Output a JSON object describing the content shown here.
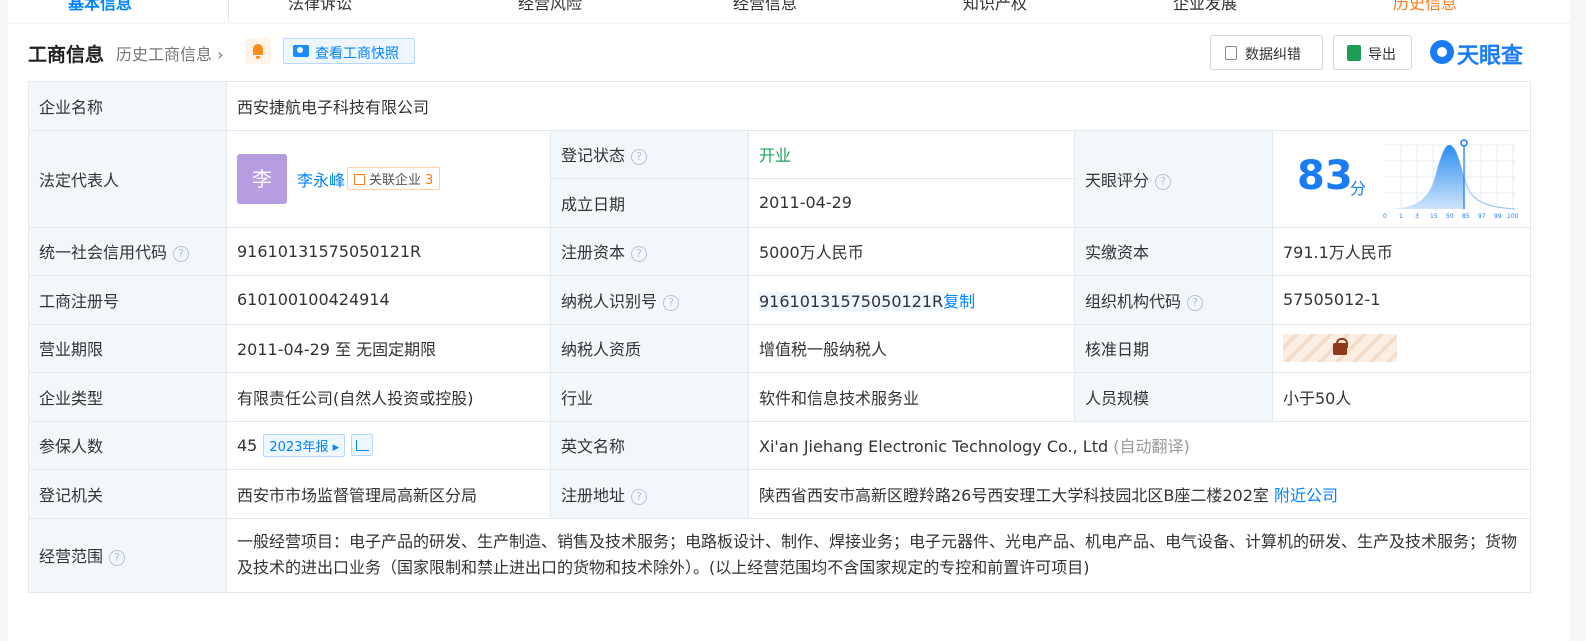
{
  "tabs": [
    {
      "label": "基本信息",
      "active": true
    },
    {
      "label": "法律诉讼"
    },
    {
      "label": "经营风险"
    },
    {
      "label": "经营信息"
    },
    {
      "label": "知识产权"
    },
    {
      "label": "企业发展"
    },
    {
      "label": "历史信息"
    }
  ],
  "header": {
    "title": "工商信息",
    "history": "历史工商信息",
    "snapshot_label": "查看工商快照",
    "correct_label": "数据纠错",
    "export_label": "导出",
    "logo_text": "天眼查"
  },
  "colors": {
    "accent": "#0084ff",
    "green": "#1aa35a",
    "orange": "#ff7a1a",
    "key_bg": "#f2f7fc"
  },
  "info": {
    "company_name_label": "企业名称",
    "company_name": "西安捷航电子科技有限公司",
    "legal_rep_label": "法定代表人",
    "legal_rep_avatar": "李",
    "legal_rep_name": "李永峰",
    "related_label": "关联企业",
    "related_count": "3",
    "reg_status_label": "登记状态",
    "reg_status": "开业",
    "found_date_label": "成立日期",
    "found_date": "2011-04-29",
    "score_label": "天眼评分",
    "score": "83",
    "score_unit": "分",
    "score_ticks": [
      "0",
      "1",
      "3",
      "15",
      "50",
      "85",
      "97",
      "99",
      "100"
    ],
    "credit_code_label": "统一社会信用代码",
    "credit_code": "91610131575050121R",
    "reg_capital_label": "注册资本",
    "reg_capital": "5000万人民币",
    "paid_capital_label": "实缴资本",
    "paid_capital": "791.1万人民币",
    "biz_reg_no_label": "工商注册号",
    "biz_reg_no": "610100100424914",
    "taxpayer_id_label": "纳税人识别号",
    "taxpayer_id": "91610131575050121R",
    "copy_label": "复制",
    "org_code_label": "组织机构代码",
    "org_code": "57505012-1",
    "term_label": "营业期限",
    "term": "2011-04-29 至 无固定期限",
    "taxpayer_qual_label": "纳税人资质",
    "taxpayer_qual": "增值税一般纳税人",
    "approve_date_label": "核准日期",
    "company_type_label": "企业类型",
    "company_type": "有限责任公司(自然人投资或控股)",
    "industry_label": "行业",
    "industry": "软件和信息技术服务业",
    "staff_size_label": "人员规模",
    "staff_size": "小于50人",
    "insured_label": "参保人数",
    "insured": "45",
    "report_label": "2023年报",
    "english_name_label": "英文名称",
    "english_name": "Xi'an Jiehang Electronic Technology Co., Ltd",
    "auto_translate": "(自动翻译)",
    "reg_authority_label": "登记机关",
    "reg_authority": "西安市市场监督管理局高新区分局",
    "reg_address_label": "注册地址",
    "reg_address": "陕西省西安市高新区瞪羚路26号西安理工大学科技园北区B座二楼202室",
    "nearby_label": "附近公司",
    "scope_label": "经营范围",
    "scope": "一般经营项目：电子产品的研发、生产制造、销售及技术服务；电路板设计、制作、焊接业务；电子元器件、光电产品、机电产品、电气设备、计算机的研发、生产及技术服务；货物及技术的进出口业务（国家限制和禁止进出口的货物和技术除外）。(以上经营范围均不含国家规定的专控和前置许可项目)"
  }
}
